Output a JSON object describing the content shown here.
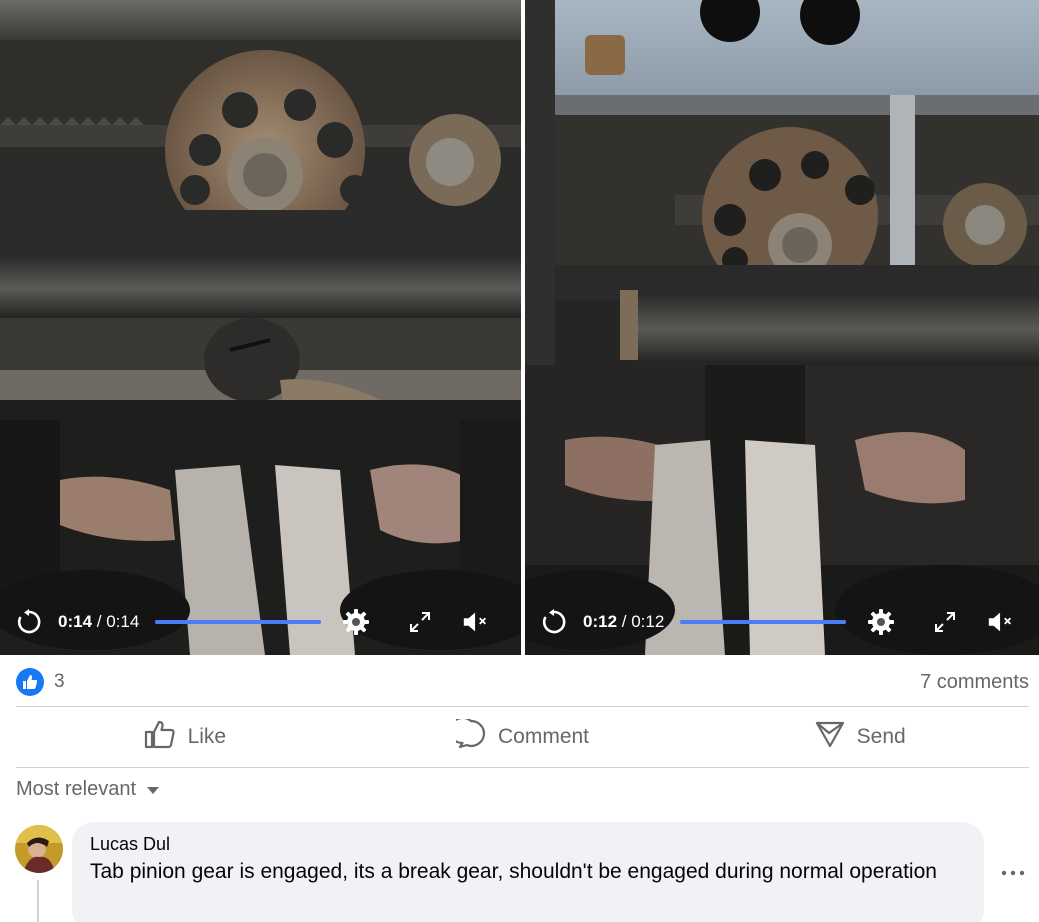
{
  "videos": [
    {
      "current_time": "0:14",
      "separator": " / ",
      "duration": "0:14",
      "progress": 1.0,
      "muted": true,
      "icons": [
        "replay-icon",
        "settings-icon",
        "fullscreen-icon",
        "volume-muted-icon"
      ]
    },
    {
      "current_time": "0:12",
      "separator": " / ",
      "duration": "0:12",
      "progress": 1.0,
      "muted": true,
      "icons": [
        "replay-icon",
        "settings-icon",
        "fullscreen-icon",
        "volume-muted-icon"
      ]
    }
  ],
  "reactions": {
    "like_count": "3",
    "comments_label": "7 comments"
  },
  "actions": {
    "like": "Like",
    "comment": "Comment",
    "send": "Send"
  },
  "sort": {
    "label": "Most relevant"
  },
  "comment": {
    "author": "Lucas Dul",
    "text": "Tab pinion gear is engaged, its a break gear, shouldn't be engaged during normal operation"
  },
  "colors": {
    "progress": "#4b7ef6",
    "like_blue": "#1877f2",
    "muted_text": "#65676b",
    "bubble_bg": "#f0f2f5"
  }
}
